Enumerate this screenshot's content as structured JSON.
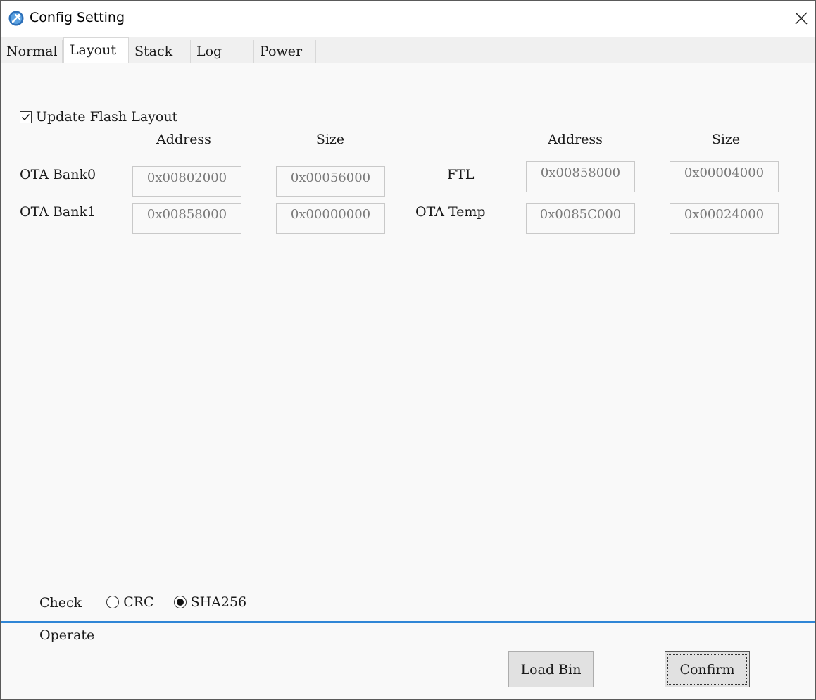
{
  "window": {
    "title": "Config Setting"
  },
  "tabs": [
    {
      "label": "Normal",
      "active": false
    },
    {
      "label": "Layout",
      "active": true
    },
    {
      "label": "Stack",
      "active": false
    },
    {
      "label": "Log",
      "active": false
    },
    {
      "label": "Power",
      "active": false
    }
  ],
  "layout": {
    "update_flash_label": "Update Flash Layout",
    "update_flash_checked": true,
    "headers": {
      "address_left": "Address",
      "size_left": "Size",
      "address_right": "Address",
      "size_right": "Size"
    },
    "rows": [
      {
        "label_left": "OTA Bank0",
        "address_left": "0x00802000",
        "size_left": "0x00056000",
        "label_right": "FTL",
        "address_right": "0x00858000",
        "size_right": "0x00004000"
      },
      {
        "label_left": "OTA Bank1",
        "address_left": "0x00858000",
        "size_left": "0x00000000",
        "label_right": "OTA Temp",
        "address_right": "0x0085C000",
        "size_right": "0x00024000"
      }
    ]
  },
  "check": {
    "label": "Check",
    "options": [
      {
        "label": "CRC",
        "selected": false
      },
      {
        "label": "SHA256",
        "selected": true
      }
    ]
  },
  "operate": {
    "label": "Operate",
    "load_bin": "Load Bin",
    "confirm": "Confirm"
  },
  "colors": {
    "divider": "#2f86d6",
    "app_icon": "#2c6fb8"
  },
  "icons": {
    "app": "app-gear-icon",
    "close": "close-icon",
    "check": "checkmark-icon"
  }
}
